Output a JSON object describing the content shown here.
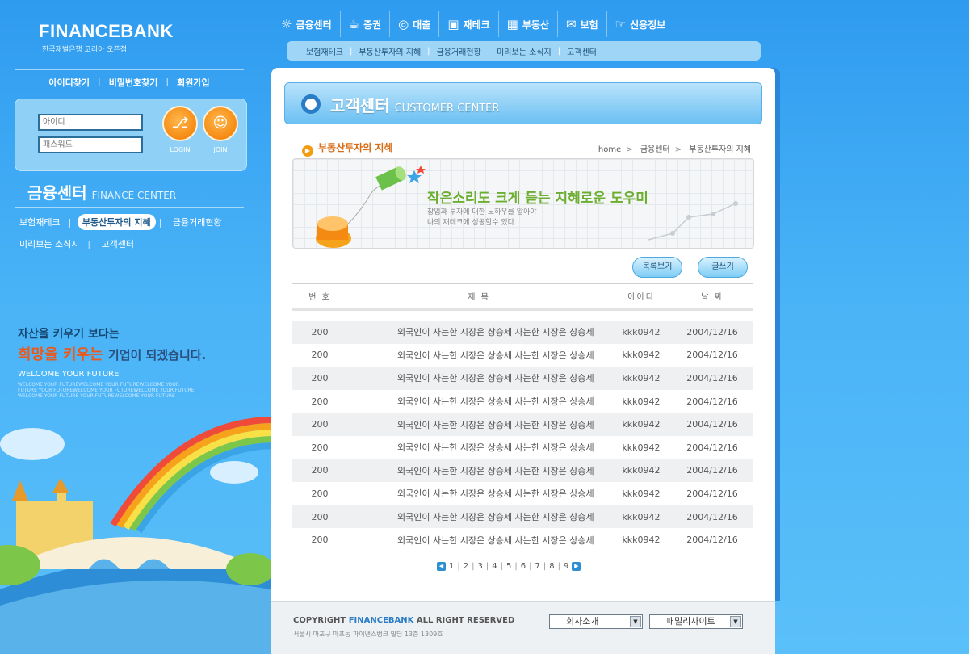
{
  "brand": {
    "name": "FINANCEBANK",
    "tagline": "한국재벌은행 코리아 오픈점"
  },
  "account_links": [
    "아이디찾기",
    "비밀번호찾기",
    "회원가입"
  ],
  "login": {
    "id_placeholder": "아이디",
    "password_placeholder": "패스워드",
    "login_label": "LOGIN",
    "join_label": "JOIN"
  },
  "left_section": {
    "title": "금융센터",
    "title_en": "FINANCE CENTER",
    "menu": [
      "보험재테크",
      "부동산투자의 지혜",
      "금융거래현황",
      "미리보는 소식지",
      "고객센터"
    ],
    "active_index": 1
  },
  "slogan": {
    "line1": "자산을 키우기 보다는",
    "line2_highlight": "희망을 키우는",
    "line2_rest": "기업이 되겠습니다.",
    "welcome": "WELCOME YOUR FUTURE",
    "fine_print": "WELCOME YOUR FUTUREWELCOME YOUR FUTUREWELCOME YOUR FUTURE YOUR FUTUREWELCOME YOUR FUTUREWELCOME YOUR FUTURE WELCOME YOUR FUTURE YOUR FUTUREWELCOME YOUR FUTURE"
  },
  "top_nav": [
    {
      "label": "금융센터",
      "icon": "sun-icon"
    },
    {
      "label": "증권",
      "icon": "cup-icon"
    },
    {
      "label": "대출",
      "icon": "circle-icon"
    },
    {
      "label": "재테크",
      "icon": "bag-icon"
    },
    {
      "label": "부동산",
      "icon": "building-icon"
    },
    {
      "label": "보험",
      "icon": "envelope-icon"
    },
    {
      "label": "신용정보",
      "icon": "hand-icon"
    }
  ],
  "sub_nav": [
    "보험재테크",
    "부동산투자의 지혜",
    "금융거래현황",
    "미리보는 소식지",
    "고객센터"
  ],
  "banner": {
    "title": "고객센터",
    "title_en": "CUSTOMER CENTER"
  },
  "page": {
    "heading": "부동산투자의 지혜",
    "breadcrumb": [
      "home",
      "금융센터",
      "부동산투자의 지혜"
    ]
  },
  "promo": {
    "headline": "작은소리도 크게 듣는 지혜로운 도우미",
    "desc_line1": "창업과 투자에 대한 노하우를 알아야",
    "desc_line2": "나의 재테크에 성공할수 있다."
  },
  "buttons": {
    "list": "목록보기",
    "write": "글쓰기"
  },
  "table": {
    "headers": [
      "번 호",
      "제 목",
      "아이디",
      "날 짜"
    ],
    "rows": [
      [
        "200",
        "외국인이 사는한 시장은 상승세 사는한 시장은 상승세",
        "kkk0942",
        "2004/12/16"
      ],
      [
        "200",
        "외국인이 사는한 시장은 상승세 사는한 시장은 상승세",
        "kkk0942",
        "2004/12/16"
      ],
      [
        "200",
        "외국인이 사는한 시장은 상승세 사는한 시장은 상승세",
        "kkk0942",
        "2004/12/16"
      ],
      [
        "200",
        "외국인이 사는한 시장은 상승세 사는한 시장은 상승세",
        "kkk0942",
        "2004/12/16"
      ],
      [
        "200",
        "외국인이 사는한 시장은 상승세 사는한 시장은 상승세",
        "kkk0942",
        "2004/12/16"
      ],
      [
        "200",
        "외국인이 사는한 시장은 상승세 사는한 시장은 상승세",
        "kkk0942",
        "2004/12/16"
      ],
      [
        "200",
        "외국인이 사는한 시장은 상승세 사는한 시장은 상승세",
        "kkk0942",
        "2004/12/16"
      ],
      [
        "200",
        "외국인이 사는한 시장은 상승세 사는한 시장은 상승세",
        "kkk0942",
        "2004/12/16"
      ],
      [
        "200",
        "외국인이 사는한 시장은 상승세 사는한 시장은 상승세",
        "kkk0942",
        "2004/12/16"
      ],
      [
        "200",
        "외국인이 사는한 시장은 상승세 사는한 시장은 상승세",
        "kkk0942",
        "2004/12/16"
      ]
    ]
  },
  "pagination": {
    "pages": [
      "1",
      "2",
      "3",
      "4",
      "5",
      "6",
      "7",
      "8",
      "9"
    ]
  },
  "footer": {
    "copyright_prefix": "COPYRIGHT",
    "copyright_brand": "FINANCEBANK",
    "copyright_suffix": "ALL RIGHT RESERVED",
    "address": "서울시 마포구 마포동 파이낸스뱅크 빌딩 13층 1309호",
    "select1": "회사소개",
    "select2": "패밀리사이트"
  },
  "colors": {
    "accent": "#2a7cc6",
    "orange": "#f58a12",
    "green_headline": "#6cae2f"
  }
}
